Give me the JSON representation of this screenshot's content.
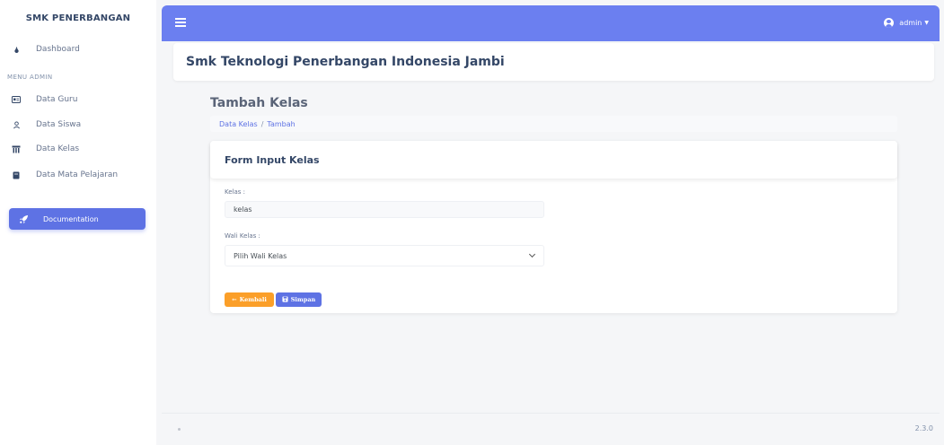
{
  "sidebar": {
    "brand": "SMK PENERBANGAN",
    "dashboard": "Dashboard",
    "section_label": "MENU ADMIN",
    "items": [
      {
        "label": "Data Guru",
        "icon": "id-card-icon"
      },
      {
        "label": "Data Siswa",
        "icon": "user-icon"
      },
      {
        "label": "Data Kelas",
        "icon": "building-icon"
      },
      {
        "label": "Data Mata Pelajaran",
        "icon": "book-icon"
      }
    ],
    "documentation": "Documentation"
  },
  "topbar": {
    "user": "admin"
  },
  "header": {
    "school_title": "Smk Teknologi Penerbangan Indonesia Jambi"
  },
  "page": {
    "title": "Tambah Kelas",
    "breadcrumb": [
      "Data Kelas",
      "Tambah"
    ]
  },
  "form": {
    "title": "Form Input Kelas",
    "kelas_label": "Kelas :",
    "kelas_value": "kelas",
    "wali_label": "Wali Kelas :",
    "wali_selected": "Pilih Wali Kelas",
    "back_label": "Kembali",
    "save_label": "Simpan"
  },
  "footer": {
    "version": "2.3.0"
  },
  "colors": {
    "accent": "#5e72e4",
    "topbar": "#6b7ff0",
    "back_button": "#fb9f29"
  }
}
